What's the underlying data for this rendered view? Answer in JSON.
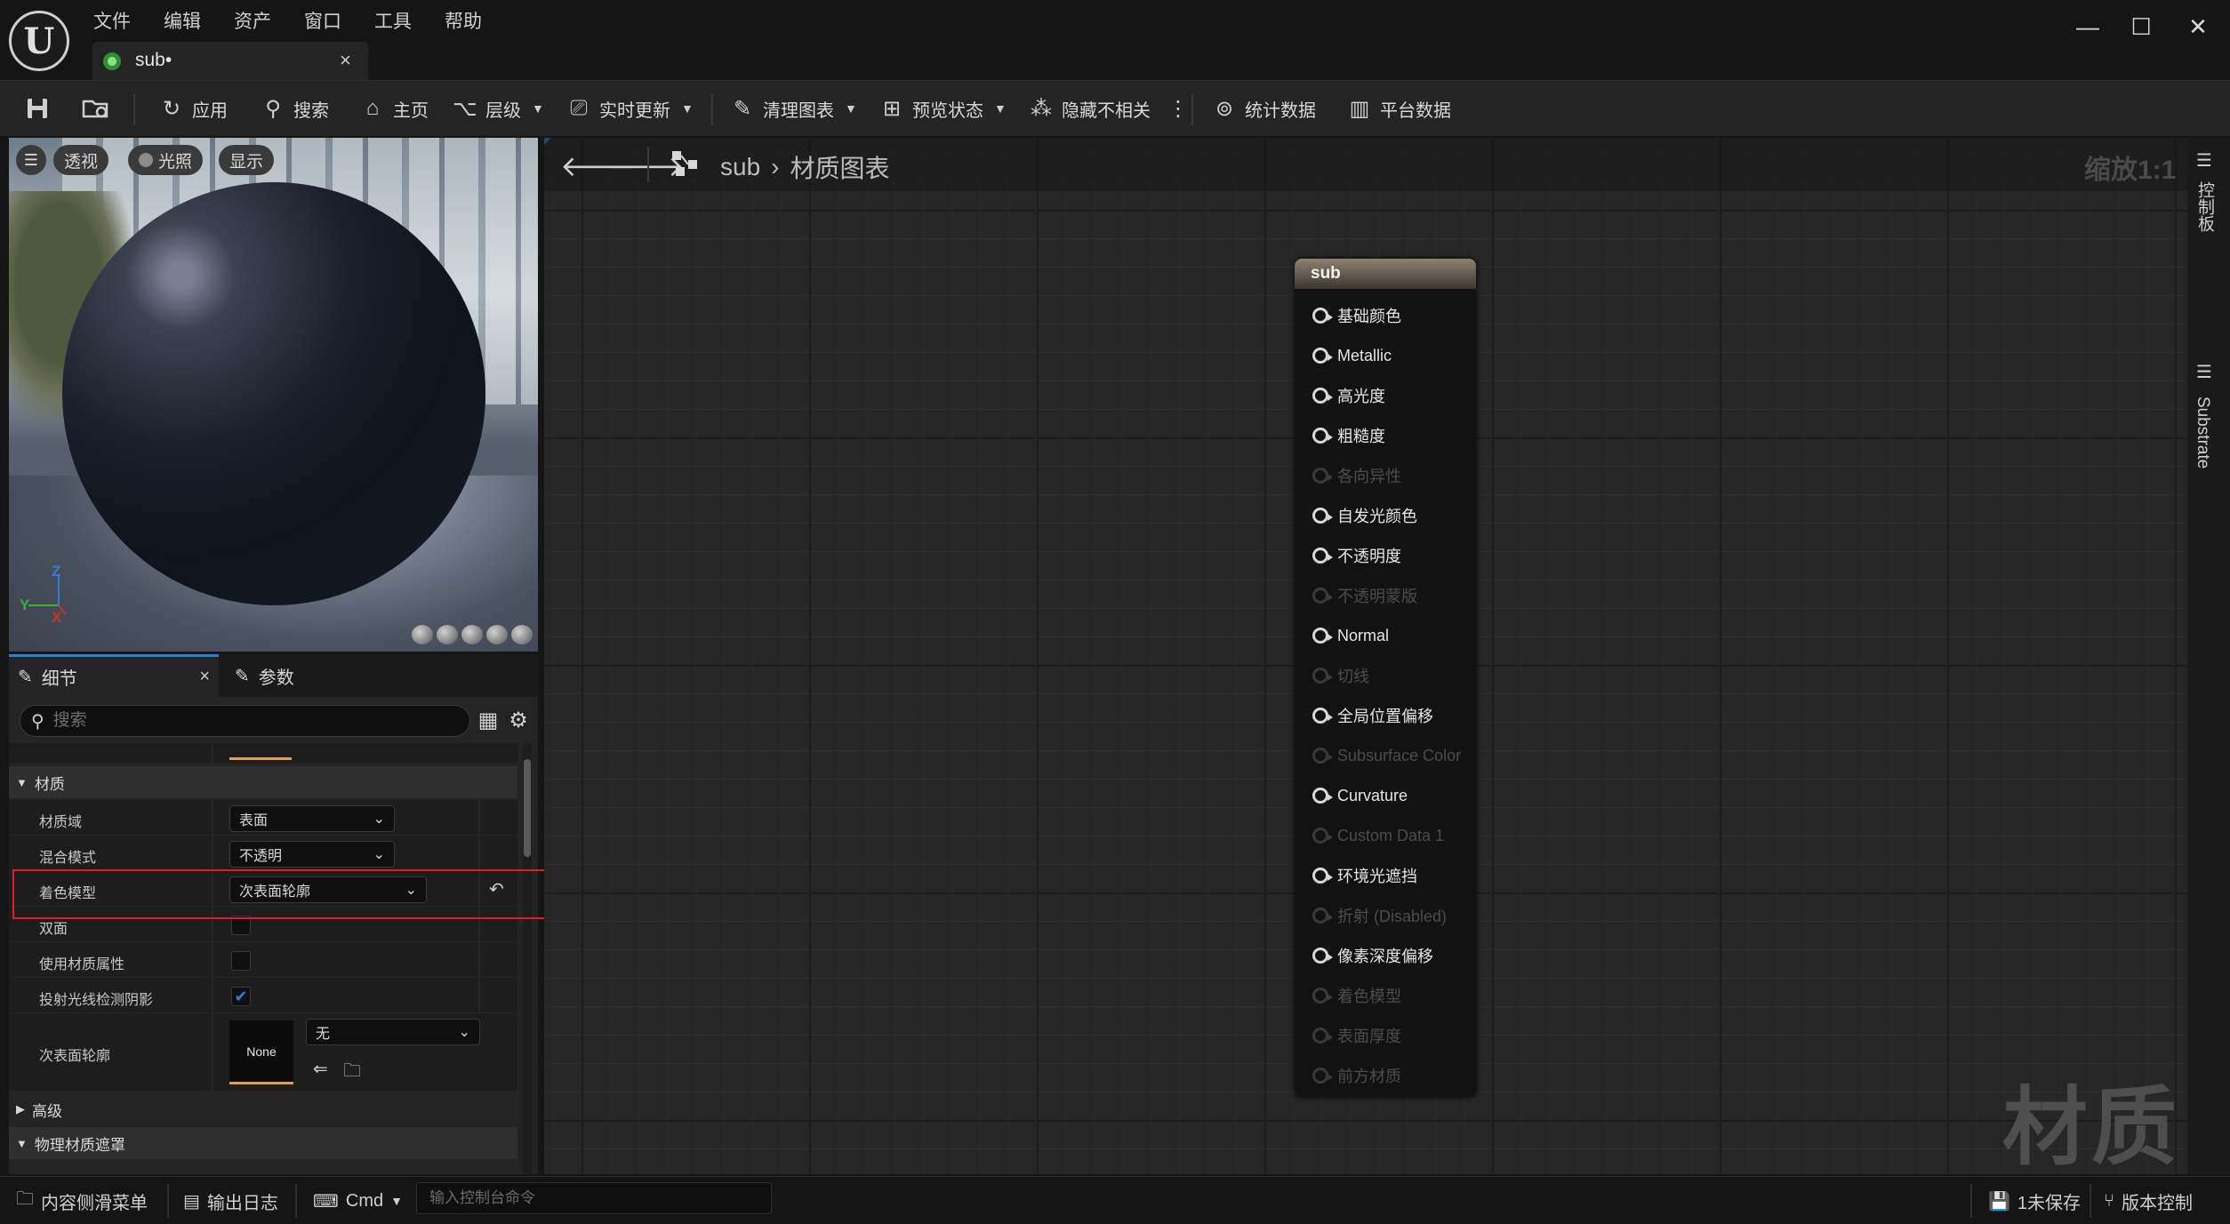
{
  "titlebar": {
    "logo": "U",
    "menu": [
      "文件",
      "编辑",
      "资产",
      "窗口",
      "工具",
      "帮助"
    ],
    "tab": {
      "label": "sub•",
      "close": "×"
    },
    "window": {
      "minimize": "—",
      "maximize": "☐",
      "close": "✕"
    }
  },
  "toolbar": {
    "apply": "应用",
    "search": "搜索",
    "home": "主页",
    "hierarchy": "层级",
    "live_update": "实时更新",
    "clean_graph": "清理图表",
    "preview_state": "预览状态",
    "hide_unrelated": "隐藏不相关",
    "stats": "统计数据",
    "platform_stats": "平台数据"
  },
  "viewport": {
    "perspective": "透视",
    "lighting": "光照",
    "show": "显示",
    "axis": {
      "z": "Z",
      "y": "Y",
      "x": "X"
    }
  },
  "details": {
    "tabs": [
      {
        "label": "细节",
        "close": "×"
      },
      {
        "label": "参数"
      }
    ],
    "search_placeholder": "搜索",
    "categories": {
      "material": "材质",
      "advanced": "高级",
      "physical_mask": "物理材质遮罩"
    },
    "rows": {
      "material_domain": {
        "name": "材质域",
        "value": "表面"
      },
      "blend_mode": {
        "name": "混合模式",
        "value": "不透明"
      },
      "shading_model": {
        "name": "着色模型",
        "value": "次表面轮廓"
      },
      "two_sided": {
        "name": "双面",
        "checked": false
      },
      "use_material_attributes": {
        "name": "使用材质属性",
        "checked": false
      },
      "cast_ray_traced_shadows": {
        "name": "投射光线检测阴影",
        "checked": true
      },
      "subsurface_profile": {
        "name": "次表面轮廓",
        "thumb": "None",
        "value": "无"
      }
    }
  },
  "graph": {
    "breadcrumb": {
      "asset": "sub",
      "sep": "›",
      "graph": "材质图表"
    },
    "zoom": "缩放1:1",
    "watermark": "材质",
    "node": {
      "title": "sub",
      "pins": [
        {
          "label": "基础颜色",
          "enabled": true
        },
        {
          "label": "Metallic",
          "enabled": true
        },
        {
          "label": "高光度",
          "enabled": true
        },
        {
          "label": "粗糙度",
          "enabled": true
        },
        {
          "label": "各向异性",
          "enabled": false
        },
        {
          "label": "自发光颜色",
          "enabled": true
        },
        {
          "label": "不透明度",
          "enabled": true
        },
        {
          "label": "不透明蒙版",
          "enabled": false
        },
        {
          "label": "Normal",
          "enabled": true
        },
        {
          "label": "切线",
          "enabled": false
        },
        {
          "label": "全局位置偏移",
          "enabled": true
        },
        {
          "label": "Subsurface Color",
          "enabled": false
        },
        {
          "label": "Curvature",
          "enabled": true
        },
        {
          "label": "Custom Data 1",
          "enabled": false
        },
        {
          "label": "环境光遮挡",
          "enabled": true
        },
        {
          "label": "折射 (Disabled)",
          "enabled": false
        },
        {
          "label": "像素深度偏移",
          "enabled": true
        },
        {
          "label": "着色模型",
          "enabled": false
        },
        {
          "label": "表面厚度",
          "enabled": false
        },
        {
          "label": "前方材质",
          "enabled": false
        }
      ]
    }
  },
  "right_tabs": {
    "palette": "控制板",
    "substrate": "Substrate"
  },
  "statusbar": {
    "content_drawer": "内容侧滑菜单",
    "output_log": "输出日志",
    "cmd": "Cmd",
    "cmd_placeholder": "输入控制台命令",
    "unsaved": "1未保存",
    "source_control": "版本控制"
  },
  "colors": {
    "accent": "#2f7fd9",
    "highlight": "#e02020",
    "node_header": "#8e8170"
  }
}
